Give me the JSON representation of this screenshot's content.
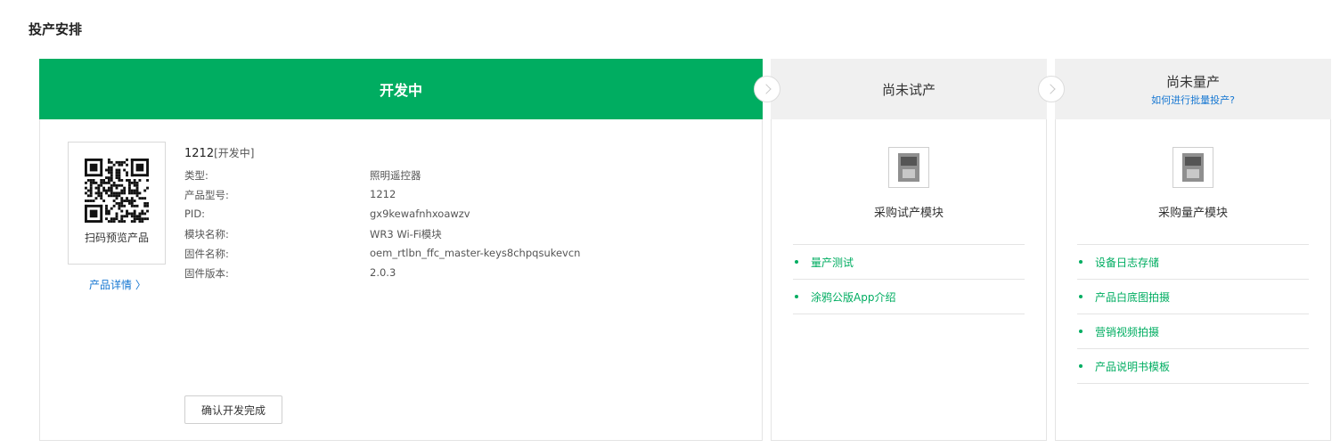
{
  "page_title": "投产安排",
  "stages": {
    "dev": {
      "title": "开发中"
    },
    "trial": {
      "title": "尚未试产"
    },
    "mass": {
      "title": "尚未量产",
      "help_link": "如何进行批量投产?"
    }
  },
  "product": {
    "qr_label": "扫码预览产品",
    "detail_link": "产品详情 〉",
    "name": "1212",
    "status": "[开发中]",
    "fields": [
      {
        "label": "类型:",
        "value": "照明遥控器"
      },
      {
        "label": "产品型号:",
        "value": "1212"
      },
      {
        "label": "PID:",
        "value": "gx9kewafnhxoawzv"
      },
      {
        "label": "模块名称:",
        "value": "WR3 Wi-Fi模块"
      },
      {
        "label": "固件名称:",
        "value": "oem_rtlbn_ffc_master-keys8chpqsukevcn"
      },
      {
        "label": "固件版本:",
        "value": "2.0.3"
      }
    ],
    "confirm_button": "确认开发完成"
  },
  "trial": {
    "module_label": "采购试产模块",
    "links": [
      "量产测试",
      "涂鸦公版App介绍"
    ]
  },
  "mass": {
    "module_label": "采购量产模块",
    "links": [
      "设备日志存储",
      "产品白底图拍摄",
      "营销视频拍摄",
      "产品说明书模板"
    ]
  },
  "icons": [
    "qr-code-icon",
    "chevron-right-icon",
    "wifi-module-icon"
  ],
  "colors": {
    "accent": "#00ad61",
    "link": "#1677d2",
    "header_gray": "#f0f0f0"
  }
}
